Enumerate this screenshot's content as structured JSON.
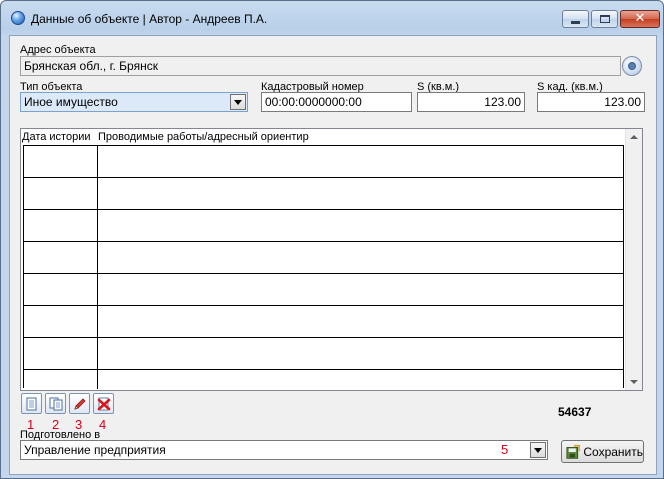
{
  "window": {
    "title": "Данные об объекте | Автор - Андреев П.А."
  },
  "address": {
    "label": "Адрес объекта",
    "value": "Брянская обл., г. Брянск"
  },
  "object_type": {
    "label": "Тип объекта",
    "value": "Иное имущество"
  },
  "cadastral": {
    "label": "Кадастровый номер",
    "value": "00:00:0000000:00"
  },
  "area": {
    "label": "S (кв.м.)",
    "value": "123.00"
  },
  "cadastral_area": {
    "label": "S кад. (кв.м.)",
    "value": "123.00"
  },
  "history_table": {
    "columns": [
      "Дата истории",
      "Проводимые работы/адресный ориентир"
    ],
    "rows": [
      [
        "",
        ""
      ],
      [
        "",
        ""
      ],
      [
        "",
        ""
      ],
      [
        "",
        ""
      ],
      [
        "",
        ""
      ],
      [
        "",
        ""
      ],
      [
        "",
        ""
      ],
      [
        "",
        ""
      ]
    ]
  },
  "toolbar": {
    "markers": [
      "1",
      "2",
      "3",
      "4"
    ],
    "icons": [
      "new-document-icon",
      "copy-document-icon",
      "pencil-icon",
      "delete-icon"
    ]
  },
  "record_count": "54637",
  "prepared_in": {
    "label": "Подготовлено в",
    "value": "Управление предприятия",
    "marker": "5"
  },
  "save_button": {
    "label": "Сохранить"
  },
  "colors": {
    "marker_red": "#d4001a",
    "title_gradient_top": "#c8dbef",
    "close_red": "#c43d20"
  }
}
